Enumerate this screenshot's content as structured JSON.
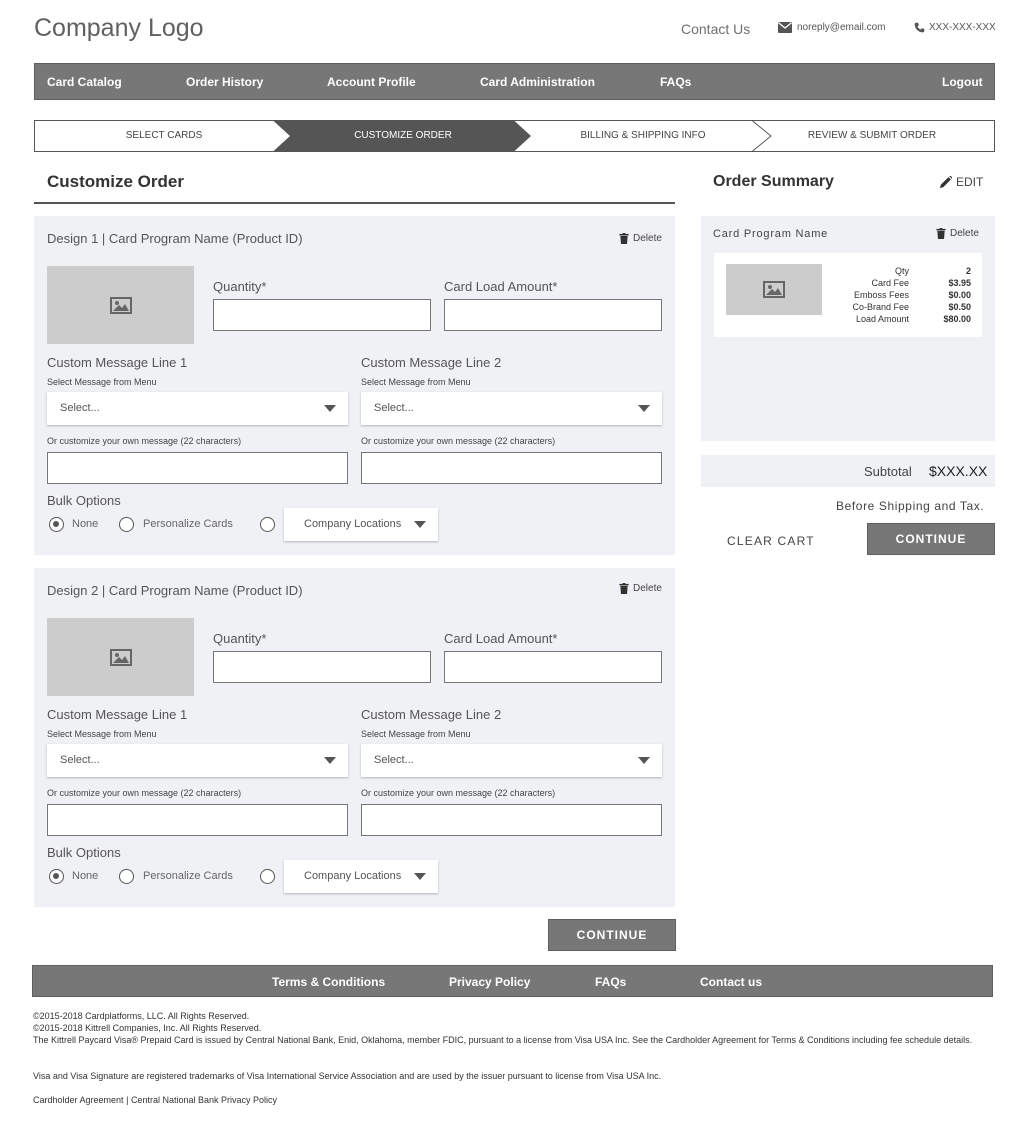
{
  "header": {
    "logo": "Company Logo",
    "contact_link": "Contact Us",
    "email": "noreply@email.com",
    "phone": "XXX-XXX-XXX"
  },
  "nav": {
    "items": [
      "Card Catalog",
      "Order History",
      "Account Profile",
      "Card Administration",
      "FAQs"
    ],
    "logout": "Logout"
  },
  "steps": {
    "items": [
      "SELECT CARDS",
      "CUSTOMIZE ORDER",
      "BILLING & SHIPPING INFO",
      "REVIEW & SUBMIT ORDER"
    ],
    "active_index": 1
  },
  "customize": {
    "title": "Customize Order",
    "designs": [
      {
        "title": "Design 1 | Card Program Name (Product ID)",
        "delete": "Delete",
        "quantity_label": "Quantity*",
        "quantity_value": "",
        "load_label": "Card Load Amount*",
        "load_value": "",
        "msg1_label": "Custom Message Line 1",
        "msg2_label": "Custom Message Line 2",
        "menu_hint": "Select Message from Menu",
        "select_placeholder": "Select...",
        "own_hint": "Or customize your own message (22 characters)",
        "bulk_label": "Bulk Options",
        "bulk_options": [
          "None",
          "Personalize Cards"
        ],
        "locations_select": "Company Locations",
        "bulk_selected": "None"
      },
      {
        "title": "Design 2 | Card Program Name (Product ID)",
        "delete": "Delete",
        "quantity_label": "Quantity*",
        "quantity_value": "",
        "load_label": "Card Load Amount*",
        "load_value": "",
        "msg1_label": "Custom Message Line 1",
        "msg2_label": "Custom Message Line 2",
        "menu_hint": "Select Message from Menu",
        "select_placeholder": "Select...",
        "own_hint": "Or customize your own message (22 characters)",
        "bulk_label": "Bulk Options",
        "bulk_options": [
          "None",
          "Personalize Cards"
        ],
        "locations_select": "Company Locations",
        "bulk_selected": "None"
      }
    ],
    "continue_label": "CONTINUE"
  },
  "summary": {
    "title": "Order Summary",
    "edit_label": "EDIT",
    "program_name": "Card Program Name",
    "delete": "Delete",
    "fees": [
      {
        "label": "Qty",
        "value": "2"
      },
      {
        "label": "Card Fee",
        "value": "$3.95"
      },
      {
        "label": "Emboss Fees",
        "value": "$0.00"
      },
      {
        "label": "Co-Brand Fee",
        "value": "$0.50"
      },
      {
        "label": "Load Amount",
        "value": "$80.00"
      }
    ],
    "subtotal_label": "Subtotal",
    "subtotal_value": "$XXX.XX",
    "before_tax": "Before Shipping and Tax.",
    "clear_cart": "CLEAR CART",
    "continue_label": "CONTINUE"
  },
  "footer": {
    "links": [
      "Terms & Conditions",
      "Privacy Policy",
      "FAQs",
      "Contact us"
    ],
    "copyright1": "©2015-2018 Cardplatforms, LLC. All Rights Reserved.",
    "copyright2": "©2015-2018 Kittrell Companies, Inc. All Rights Reserved.",
    "disclaimer": "The Kittrell Paycard Visa® Prepaid Card is issued by Central National Bank, Enid, Oklahoma, member FDIC, pursuant to a license from Visa USA Inc. See the Cardholder Agreement for Terms & Conditions including fee schedule details.",
    "trademark": "Visa and Visa Signature are registered trademarks of Visa International Service Association and are used by the issuer pursuant to license from Visa USA Inc.",
    "agreement_link": "Cardholder Agreement",
    "separator": "|",
    "privacy_link": "Central National Bank Privacy Policy"
  },
  "colors": {
    "nav_bg": "#777777",
    "active_step": "#555555",
    "panel_bg": "#f0f1f5",
    "thumb_bg": "#cccccc"
  }
}
